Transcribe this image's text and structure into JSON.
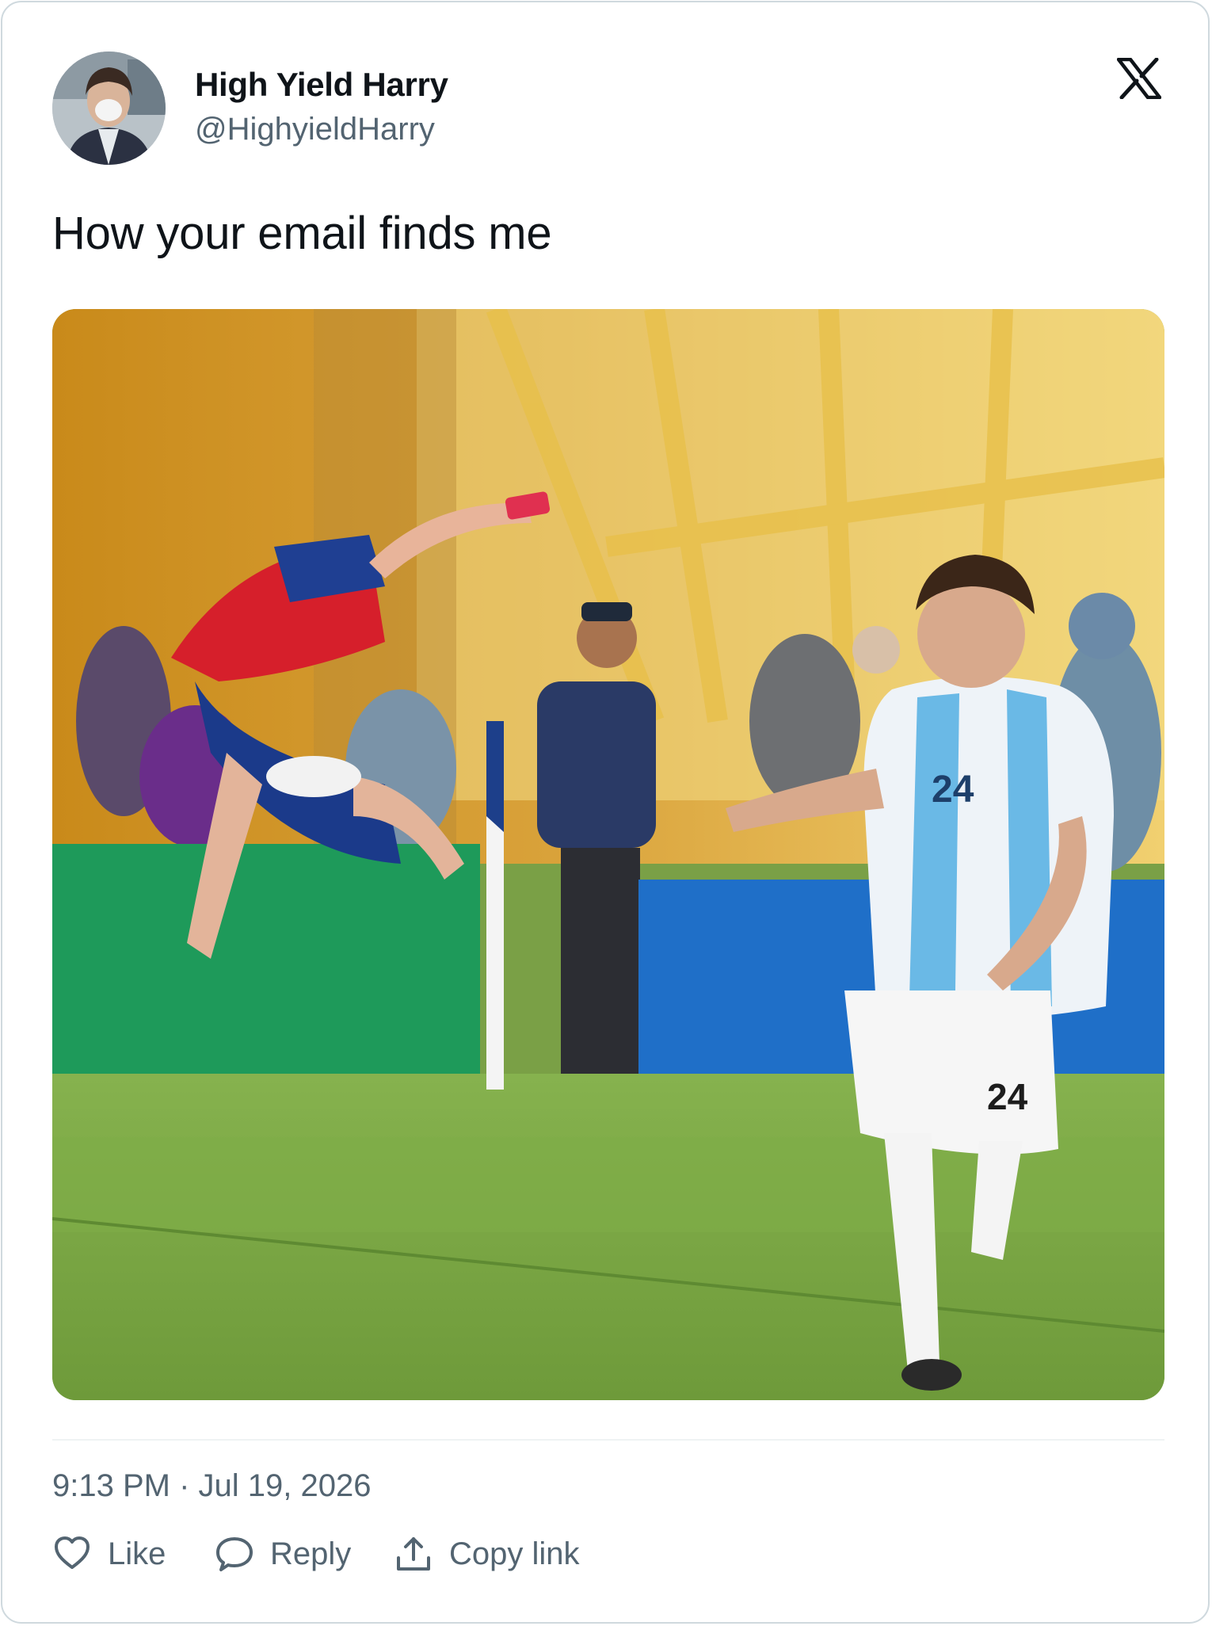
{
  "author": {
    "display_name": "High Yield Harry",
    "handle": "@HighyieldHarry"
  },
  "tweet": {
    "text": "How your email finds me",
    "timestamp": "9:13 PM · Jul 19, 2026"
  },
  "media": {
    "shirt_numbers": [
      "24",
      "24"
    ]
  },
  "actions": {
    "like": "Like",
    "reply": "Reply",
    "copy_link": "Copy link"
  },
  "colors": {
    "text_primary": "#0f1419",
    "text_secondary": "#536471",
    "border": "#cfd9de"
  }
}
